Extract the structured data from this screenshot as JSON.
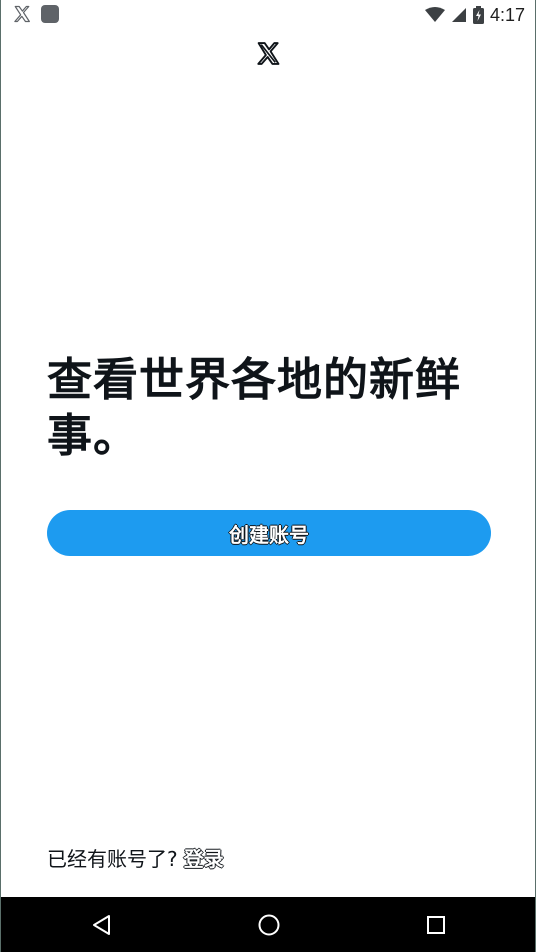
{
  "status_bar": {
    "time": "4:17",
    "icons": [
      "x-logo-icon",
      "notification-square-icon",
      "wifi-icon",
      "cellular-signal-icon",
      "battery-charging-icon"
    ]
  },
  "header": {
    "logo": "x-logo-icon"
  },
  "main": {
    "headline": "查看世界各地的新鲜事。",
    "create_account_label": "创建账号"
  },
  "footer": {
    "prompt": "已经有账号了?",
    "login_label": "登录"
  },
  "nav_bar": {
    "buttons": [
      "back-icon",
      "home-icon",
      "recents-icon"
    ]
  },
  "colors": {
    "accent": "#1d9bf0",
    "text": "#0f1419",
    "nav_background": "#000000"
  }
}
